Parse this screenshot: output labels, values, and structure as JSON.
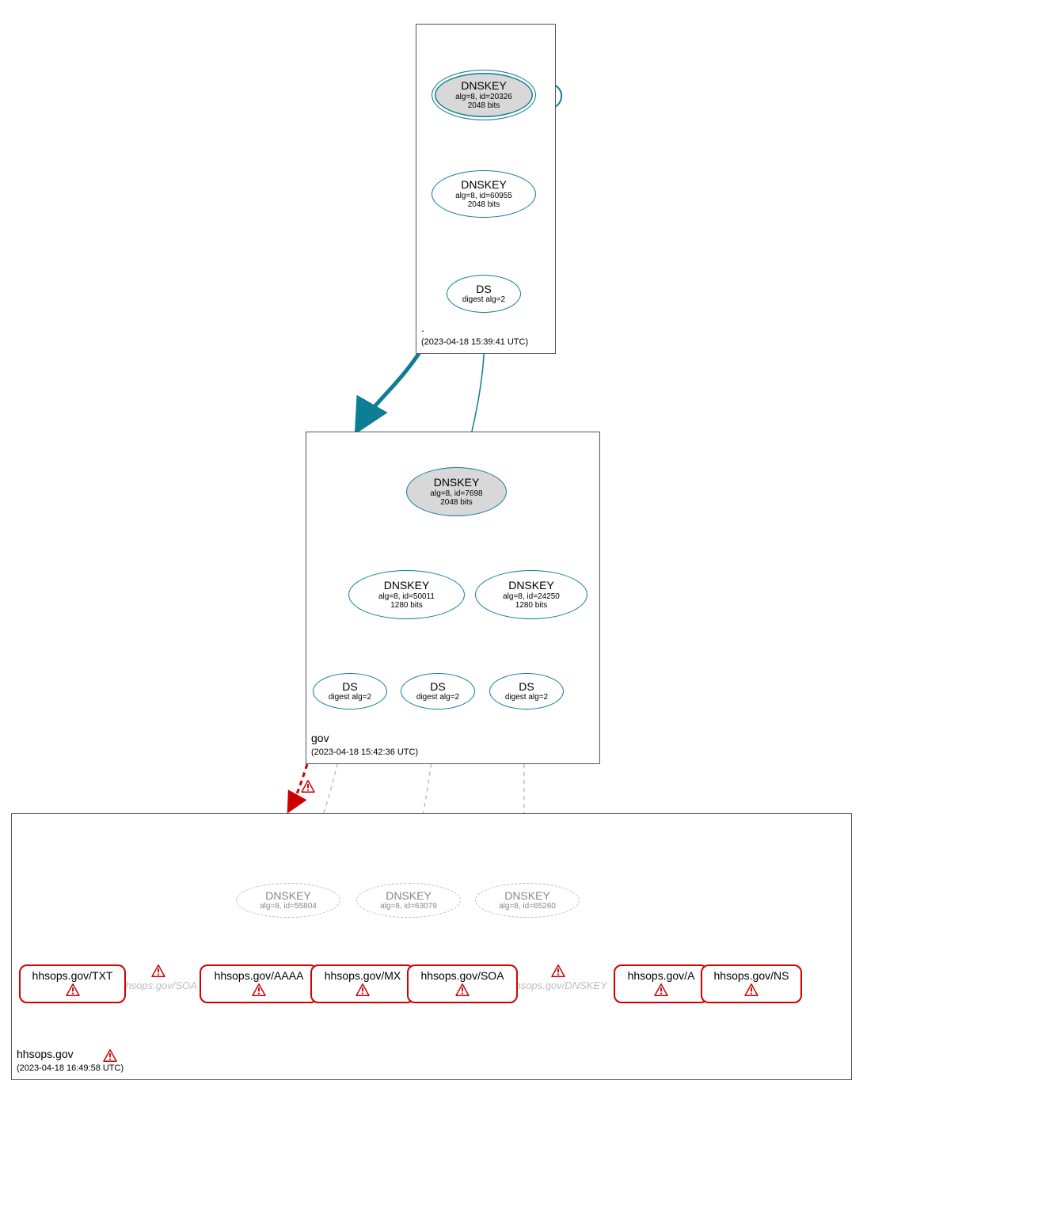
{
  "zones": {
    "root": {
      "name": ".",
      "timestamp": "(2023-04-18 15:39:41 UTC)",
      "nodes": {
        "ksk": {
          "title": "DNSKEY",
          "sub1": "alg=8, id=20326",
          "sub2": "2048 bits"
        },
        "zsk": {
          "title": "DNSKEY",
          "sub1": "alg=8, id=60955",
          "sub2": "2048 bits"
        },
        "ds": {
          "title": "DS",
          "sub1": "digest alg=2"
        }
      }
    },
    "gov": {
      "name": "gov",
      "timestamp": "(2023-04-18 15:42:36 UTC)",
      "nodes": {
        "ksk": {
          "title": "DNSKEY",
          "sub1": "alg=8, id=7698",
          "sub2": "2048 bits"
        },
        "zsk1": {
          "title": "DNSKEY",
          "sub1": "alg=8, id=50011",
          "sub2": "1280 bits"
        },
        "zsk2": {
          "title": "DNSKEY",
          "sub1": "alg=8, id=24250",
          "sub2": "1280 bits"
        },
        "ds1": {
          "title": "DS",
          "sub1": "digest alg=2"
        },
        "ds2": {
          "title": "DS",
          "sub1": "digest alg=2"
        },
        "ds3": {
          "title": "DS",
          "sub1": "digest alg=2"
        }
      }
    },
    "hhsops": {
      "name": "hhsops.gov",
      "timestamp": "(2023-04-18 16:49:58 UTC)",
      "dashed_keys": {
        "k1": {
          "title": "DNSKEY",
          "sub1": "alg=8, id=55804"
        },
        "k2": {
          "title": "DNSKEY",
          "sub1": "alg=8, id=63079"
        },
        "k3": {
          "title": "DNSKEY",
          "sub1": "alg=8, id=65260"
        }
      },
      "ghosts": {
        "soa": "hhsops.gov/SOA",
        "dnskey": "hhsops.gov/DNSKEY"
      },
      "rrsets": {
        "txt": "hhsops.gov/TXT",
        "aaaa": "hhsops.gov/AAAA",
        "mx": "hhsops.gov/MX",
        "soa": "hhsops.gov/SOA",
        "a": "hhsops.gov/A",
        "ns": "hhsops.gov/NS"
      }
    }
  },
  "colors": {
    "teal": "#0d7e93",
    "gray": "#bdbdbd",
    "red": "#cc0000"
  }
}
